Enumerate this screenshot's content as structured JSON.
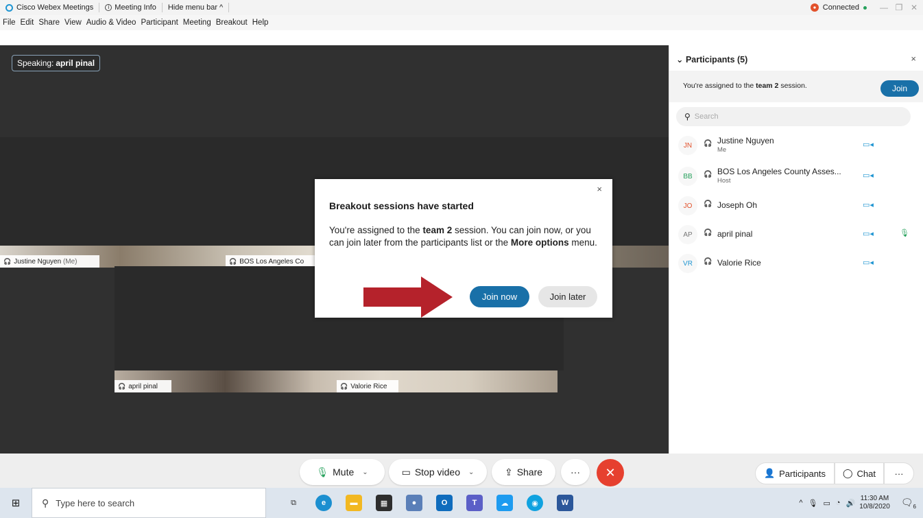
{
  "titlebar": {
    "app_name": "Cisco Webex Meetings",
    "meeting_info": "Meeting Info",
    "hide_menu": "Hide menu bar ^",
    "status": "Connected",
    "minimize": "—",
    "restore": "❐",
    "close": "✕"
  },
  "menu": [
    "File",
    "Edit",
    "Share",
    "View",
    "Audio & Video",
    "Participant",
    "Meeting",
    "Breakout",
    "Help"
  ],
  "stage": {
    "speaking_prefix": "Speaking:",
    "speaking_name": "april pinal",
    "tiles": [
      {
        "name": "Justine Nguyen",
        "suffix": "(Me)"
      },
      {
        "name": "BOS Los Angeles Co"
      },
      {
        "name": "april pinal"
      },
      {
        "name": "Valorie Rice"
      }
    ]
  },
  "dialog": {
    "title": "Breakout sessions have started",
    "text_1": "You're assigned to the ",
    "team": "team 2",
    "text_2": " session. You can join now, or you can join later from the participants list or the ",
    "more_options": "More options",
    "text_3": " menu.",
    "join_now": "Join now",
    "join_later": "Join later",
    "close": "×"
  },
  "controls": {
    "mute": "Mute",
    "stop_video": "Stop video",
    "share": "Share",
    "more": "···",
    "end": "✕",
    "participants": "Participants",
    "chat": "Chat",
    "panel_more": "···"
  },
  "panel": {
    "title": "Participants (5)",
    "assign_text_1": "You're assigned to the ",
    "assign_team": "team 2",
    "assign_text_2": " session.",
    "join": "Join",
    "search_placeholder": "Search",
    "participants": [
      {
        "initials": "JN",
        "name": "Justine Nguyen",
        "role": "Me",
        "color": "#e2512b"
      },
      {
        "initials": "BB",
        "name": "BOS Los Angeles County Asses...",
        "role": "Host",
        "color": "#25a05b"
      },
      {
        "initials": "JO",
        "name": "Joseph Oh",
        "role": "",
        "color": "#e2512b"
      },
      {
        "initials": "AP",
        "name": "april pinal",
        "role": "",
        "color": "#777777"
      },
      {
        "initials": "VR",
        "name": "Valorie Rice",
        "role": "",
        "color": "#1f95d2"
      }
    ]
  },
  "taskbar": {
    "search_placeholder": "Type here to search",
    "time": "11:30 AM",
    "date": "10/8/2020",
    "notifications": "6"
  }
}
